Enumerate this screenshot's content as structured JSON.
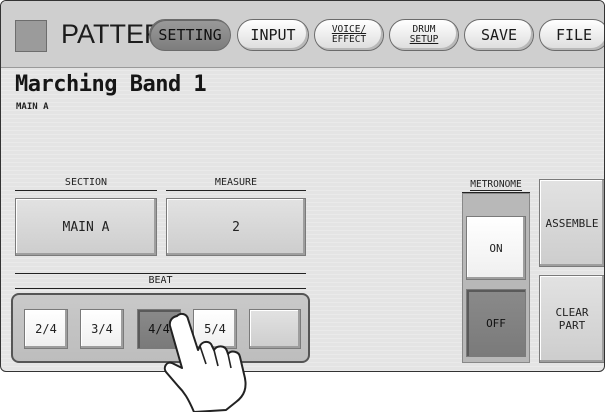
{
  "header": {
    "title": "PATTERN",
    "tabs": [
      {
        "label_lines": [
          "SETTING"
        ],
        "active": true
      },
      {
        "label_lines": [
          "INPUT"
        ],
        "active": false
      },
      {
        "label_lines": [
          "VOICE/",
          "EFFECT"
        ],
        "active": false
      },
      {
        "label_lines": [
          "DRUM",
          "SETUP"
        ],
        "active": false
      },
      {
        "label_lines": [
          "SAVE"
        ],
        "active": false
      },
      {
        "label_lines": [
          "FILE"
        ],
        "active": false
      }
    ]
  },
  "pattern": {
    "name": "Marching Band 1",
    "section_label": "MAIN A"
  },
  "section": {
    "label": "SECTION",
    "value": "MAIN A"
  },
  "measure": {
    "label": "MEASURE",
    "value": "2"
  },
  "beat": {
    "label": "BEAT",
    "options": [
      "2/4",
      "3/4",
      "4/4",
      "5/4",
      ""
    ],
    "selected": "4/4"
  },
  "metronome": {
    "label": "METRONOME",
    "on_label": "ON",
    "off_label": "OFF",
    "selected": "OFF"
  },
  "actions": {
    "assemble_label": "ASSEMBLE",
    "clear_part_lines": [
      "CLEAR",
      "PART"
    ]
  },
  "colors": {
    "selected": "#808080",
    "button": "#d8d8d8",
    "background": "#e4e4e4"
  }
}
